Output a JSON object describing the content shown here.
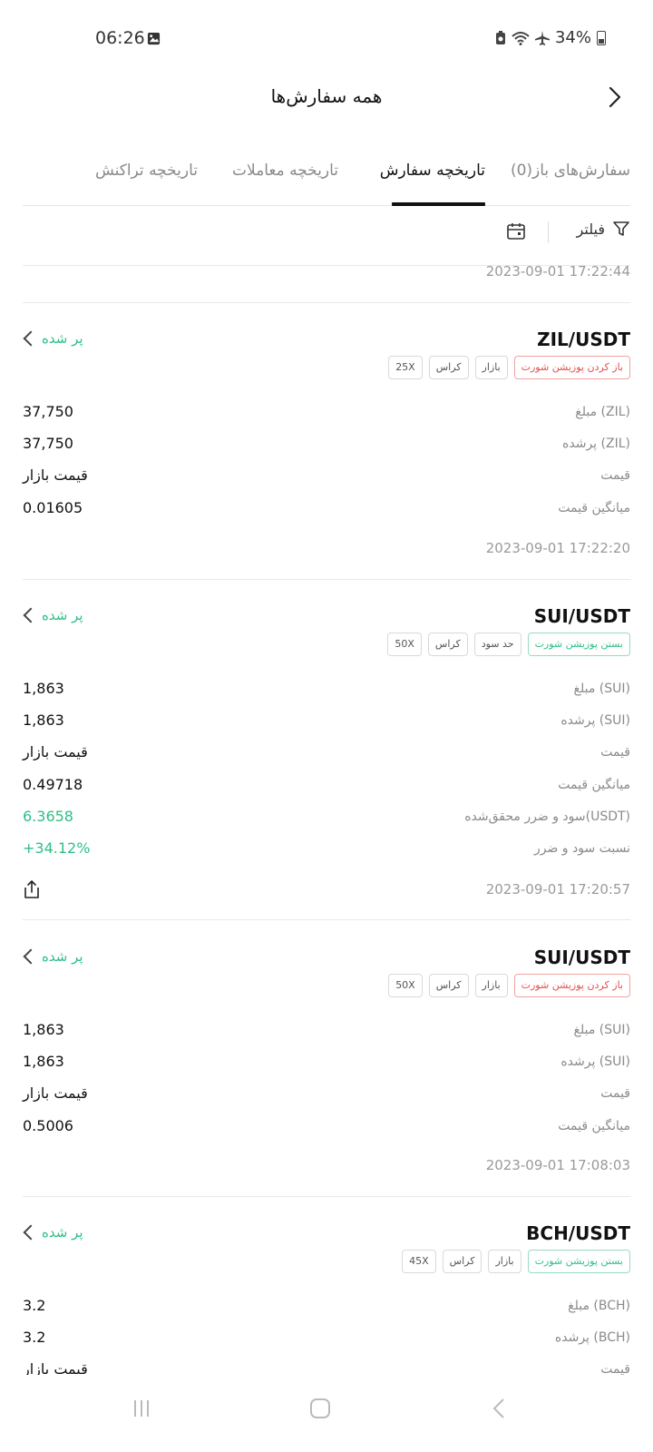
{
  "status_bar": {
    "time": "06:26",
    "battery": "34%"
  },
  "header": {
    "title": "همه سفارش‌ها"
  },
  "tabs": [
    {
      "label": "سفارش‌های باز(0)"
    },
    {
      "label": "تاریخچه سفارش"
    },
    {
      "label": "تاریخچه معاملات"
    },
    {
      "label": "تاریخچه تراکنش"
    }
  ],
  "toolbar": {
    "filter_label": "فیلتر"
  },
  "top_timestamp": "2023-09-01 17:22:44",
  "orders": [
    {
      "pair": "ZIL/USDT",
      "status": "پر شده",
      "tags": [
        "باز کردن پوزیشن شورت",
        "بازار",
        "کراس",
        "25X"
      ],
      "rows": [
        {
          "label": "مبلغ (ZIL)",
          "value": "37,750"
        },
        {
          "label": "پرشده (ZIL)",
          "value": "37,750"
        },
        {
          "label": "قیمت",
          "value": "قیمت بازار"
        },
        {
          "label": "میانگین قیمت",
          "value": "0.01605"
        }
      ],
      "timestamp": "2023-09-01 17:22:20"
    },
    {
      "pair": "SUI/USDT",
      "status": "پر شده",
      "tags": [
        "بستن پوزیشن شورت",
        "حد سود",
        "کراس",
        "50X"
      ],
      "rows": [
        {
          "label": "مبلغ (SUI)",
          "value": "1,863"
        },
        {
          "label": "پرشده (SUI)",
          "value": "1,863"
        },
        {
          "label": "قیمت",
          "value": "قیمت بازار"
        },
        {
          "label": "میانگین قیمت",
          "value": "0.49718"
        },
        {
          "label": "سود و ضرر محقق‌شده(USDT)",
          "value": "6.3658"
        },
        {
          "label": "نسبت سود و ضرر",
          "value": "+34.12%"
        }
      ],
      "timestamp": "2023-09-01 17:20:57"
    },
    {
      "pair": "SUI/USDT",
      "status": "پر شده",
      "tags": [
        "باز کردن پوزیشن شورت",
        "بازار",
        "کراس",
        "50X"
      ],
      "rows": [
        {
          "label": "مبلغ (SUI)",
          "value": "1,863"
        },
        {
          "label": "پرشده (SUI)",
          "value": "1,863"
        },
        {
          "label": "قیمت",
          "value": "قیمت بازار"
        },
        {
          "label": "میانگین قیمت",
          "value": "0.5006"
        }
      ],
      "timestamp": "2023-09-01 17:08:03"
    },
    {
      "pair": "BCH/USDT",
      "status": "پر شده",
      "tags": [
        "بستن پوزیشن شورت",
        "بازار",
        "کراس",
        "45X"
      ],
      "rows": [
        {
          "label": "مبلغ (BCH)",
          "value": "3.2"
        },
        {
          "label": "پرشده (BCH)",
          "value": "3.2"
        },
        {
          "label": "قیمت",
          "value": "قیمت بازار"
        }
      ]
    }
  ],
  "colors": {
    "profit_green": "#2fbf86",
    "loss_red": "#e2504f",
    "accent": "#111111"
  }
}
